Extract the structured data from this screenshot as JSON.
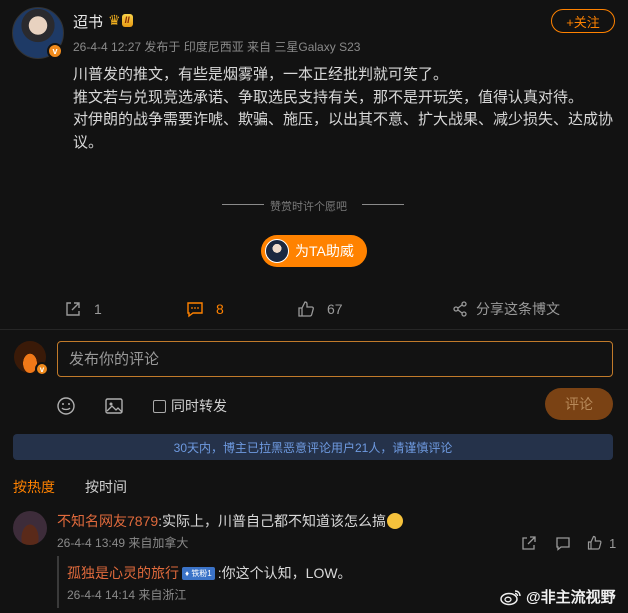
{
  "post": {
    "author": "迢书",
    "level_badge": "II",
    "meta": "26-4-4 12:27  发布于 印度尼西亚  来自 三星Galaxy S23",
    "follow_label": "+关注",
    "paragraphs": [
      "川普发的推文，有些是烟雾弹，一本正经批判就可笑了。",
      "推文若与兑现竞选承诺、争取选民支持有关，那不是开玩笑，值得认真对待。",
      "对伊朗的战争需要诈唬、欺骗、施压，以出其不意、扩大战果、减少损失、达成协议。"
    ]
  },
  "reward": {
    "text": "赞赏时许个愿吧",
    "cheer_label": "为TA助威"
  },
  "actions": {
    "repost_count": "1",
    "comment_count": "8",
    "like_count": "67",
    "share_label": "分享这条博文"
  },
  "composer": {
    "placeholder": "发布你的评论",
    "repost_label": "同时转发",
    "submit_label": "评论"
  },
  "notice": "30天内，博主已拉黑恶意评论用户21人，请谨慎评论",
  "sort_tabs": {
    "hot": "按热度",
    "time": "按时间"
  },
  "comments": [
    {
      "user": "不知名网友7879",
      "text": ":实际上，川普自己都不知道该怎么搞",
      "meta": "26-4-4 13:49  来自加拿大",
      "like_count": "1",
      "replies": [
        {
          "user": "孤独是心灵的旅行",
          "badge": "铁粉1",
          "text": ":你这个认知，LOW。",
          "meta": "26-4-4 14:14  来自浙江"
        }
      ]
    }
  ],
  "watermark": "@非主流视野",
  "colors": {
    "accent": "#ff8200",
    "background": "#121212",
    "username": "#e06a3c",
    "notice_bg": "#25324a",
    "notice_text": "#6e9ae0"
  }
}
